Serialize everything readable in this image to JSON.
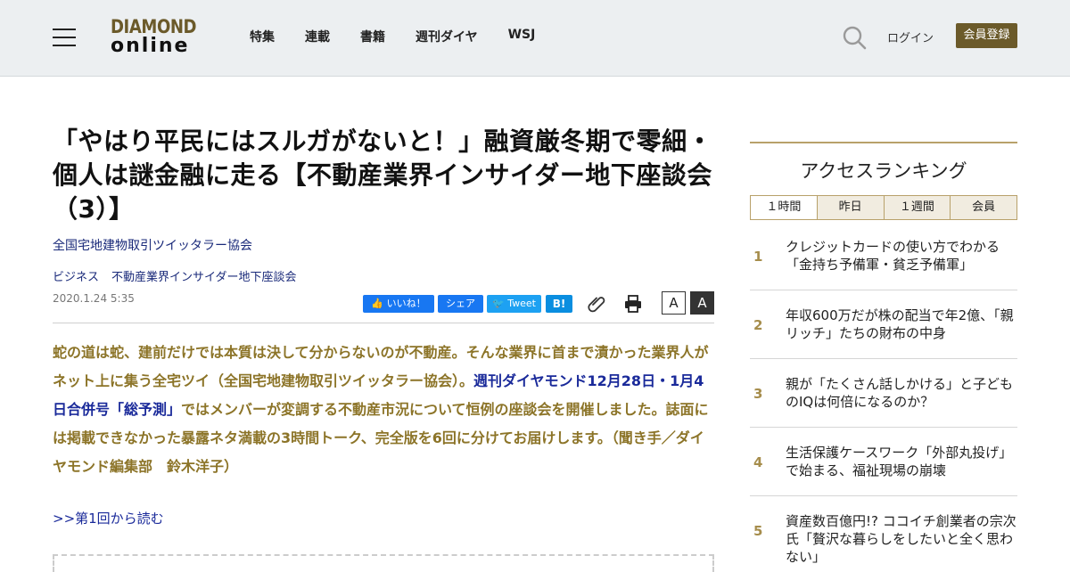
{
  "header": {
    "logo_line1": "DIAMOND",
    "logo_line2": "online",
    "nav": [
      "特集",
      "連載",
      "書籍",
      "週刊ダイヤ",
      "WSJ"
    ],
    "login": "ログイン",
    "register": "会員登録"
  },
  "article": {
    "title": "「やはり平民にはスルガがないと！」融資厳冬期で零細・個人は謎金融に走る【不動産業界インサイダー地下座談会（3）】",
    "author": "全国宅地建物取引ツイッタラー協会",
    "tags": [
      "ビジネス",
      "不動産業界インサイダー地下座談会"
    ],
    "date": "2020.1.24 5:35",
    "share": {
      "like": "いいね！",
      "fb_share": "シェア",
      "tweet": "Tweet",
      "hatena": "B!"
    },
    "font_small": "A",
    "font_large": "A",
    "lead_part1": "蛇の道は蛇、建前だけでは本質は決して分からないのが不動産。そんな業界に首まで漬かった業界人がネット上に集う全宅ツイ（全国宅地建物取引ツイッタラー協会）。",
    "lead_link": "週刊ダイヤモンド12月28日・1月4日合併号「総予測」",
    "lead_part2": "ではメンバーが変調する不動産市況について恒例の座談会を開催しました。誌面には掲載できなかった暴露ネタ満載の3時間トーク、完全版を6回に分けてお届けします。（聞き手／ダイヤモンド編集部　鈴木洋子）",
    "read_first": ">>第1回から読む"
  },
  "ranking": {
    "title": "アクセスランキング",
    "tabs": [
      "１時間",
      "昨日",
      "１週間",
      "会員"
    ],
    "items": [
      {
        "rank": "1",
        "text": "クレジットカードの使い方でわかる「金持ち予備軍・貧乏予備軍」"
      },
      {
        "rank": "2",
        "text": "年収600万だが株の配当で年2億、「親リッチ」たちの財布の中身"
      },
      {
        "rank": "3",
        "text": "親が「たくさん話しかける」と子どものIQは何倍になるのか？"
      },
      {
        "rank": "4",
        "text": "生活保護ケースワーク「外部丸投げ」で始まる、福祉現場の崩壊"
      },
      {
        "rank": "5",
        "text": "資産数百億円!? ココイチ創業者の宗次氏「贅沢な暮らしをしたいと全く思わない」"
      }
    ]
  },
  "colors": {
    "header_bg": "#eceff1",
    "brand_gold": "#6b5a2a",
    "lead_text": "#8c7428",
    "link_navy": "#1a2a9a",
    "rank_number": "#a68d4c"
  }
}
